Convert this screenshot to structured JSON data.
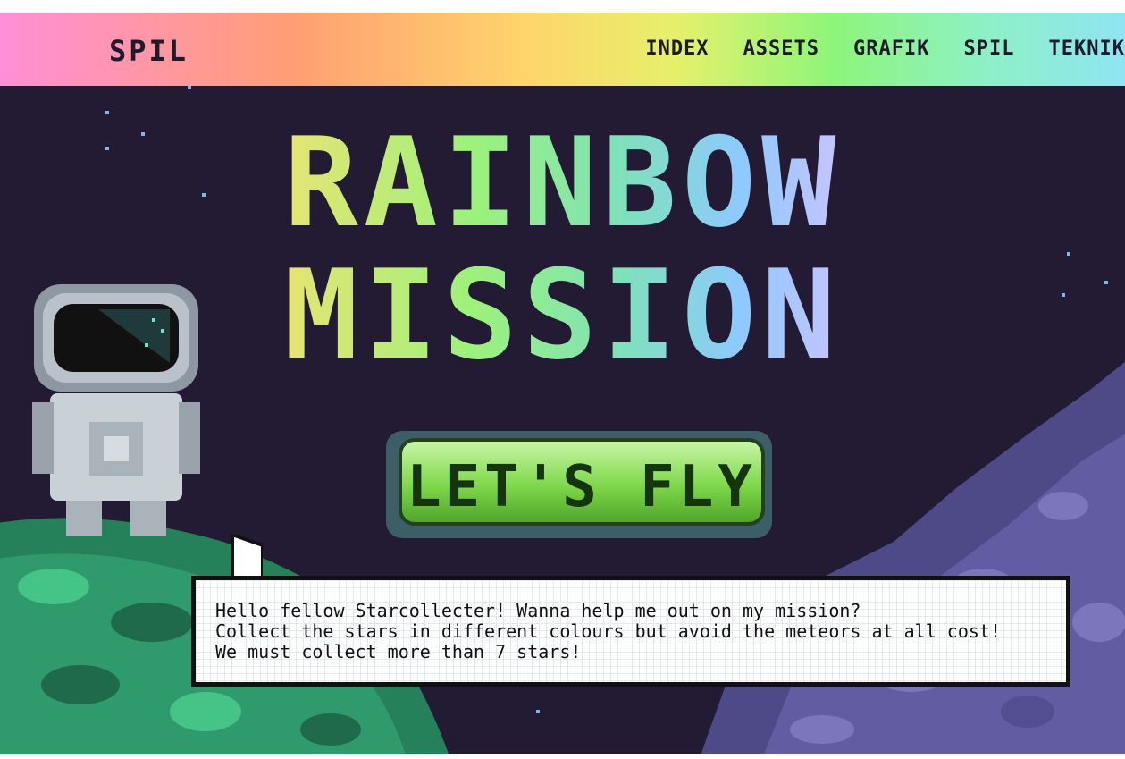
{
  "nav": {
    "brand": "SPIL",
    "links": [
      "INDEX",
      "ASSETS",
      "GRAFIK",
      "SPIL",
      "TEKNIK"
    ]
  },
  "hero": {
    "title_line1": "RAINBOW",
    "title_line2": "MISSION",
    "button_label": "LET'S FLY"
  },
  "speech": {
    "lines": [
      "Hello fellow Starcollecter! Wanna help me out on my mission?",
      "Collect the stars in different colours but avoid the meteors at all cost!",
      "We must collect more than 7 stars!"
    ]
  },
  "colors": {
    "space": "#221b33",
    "button_green": "#7fd84a",
    "planet_left": "#2f9a6b",
    "planet_right": "#5f5a9c"
  },
  "icons": [
    "astronaut-icon",
    "planet-icon",
    "star-icon"
  ]
}
